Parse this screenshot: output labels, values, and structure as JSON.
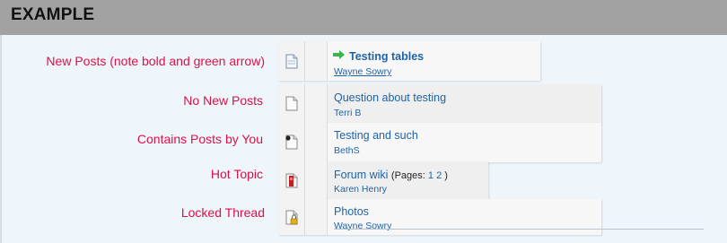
{
  "header": {
    "title": "EXAMPLE"
  },
  "rows": [
    {
      "label": "New Posts (note bold and green arrow)",
      "title": "Testing tables",
      "author": "Wayne Sowry",
      "icon": "document-new-icon"
    },
    {
      "label": "No New Posts",
      "title": "Question about testing",
      "author": "Terri B",
      "icon": "document-icon"
    },
    {
      "label": "Contains Posts by You",
      "title": "Testing and such",
      "author": "BethS",
      "icon": "document-dot-icon"
    },
    {
      "label": "Hot Topic",
      "title": "Forum wiki",
      "pages_prefix": "(Pages:",
      "page1": "1",
      "page2": "2",
      "pages_suffix": ")",
      "author": "Karen Henry",
      "icon": "hot-document-icon"
    },
    {
      "label": "Locked Thread",
      "title": "Photos",
      "author": "Wayne Sowry",
      "icon": "locked-document-icon"
    }
  ],
  "colors": {
    "label": "#dd1144",
    "link": "#1f63a6",
    "header_bg": "#a2a2a2",
    "arrow": "#3bb449"
  }
}
